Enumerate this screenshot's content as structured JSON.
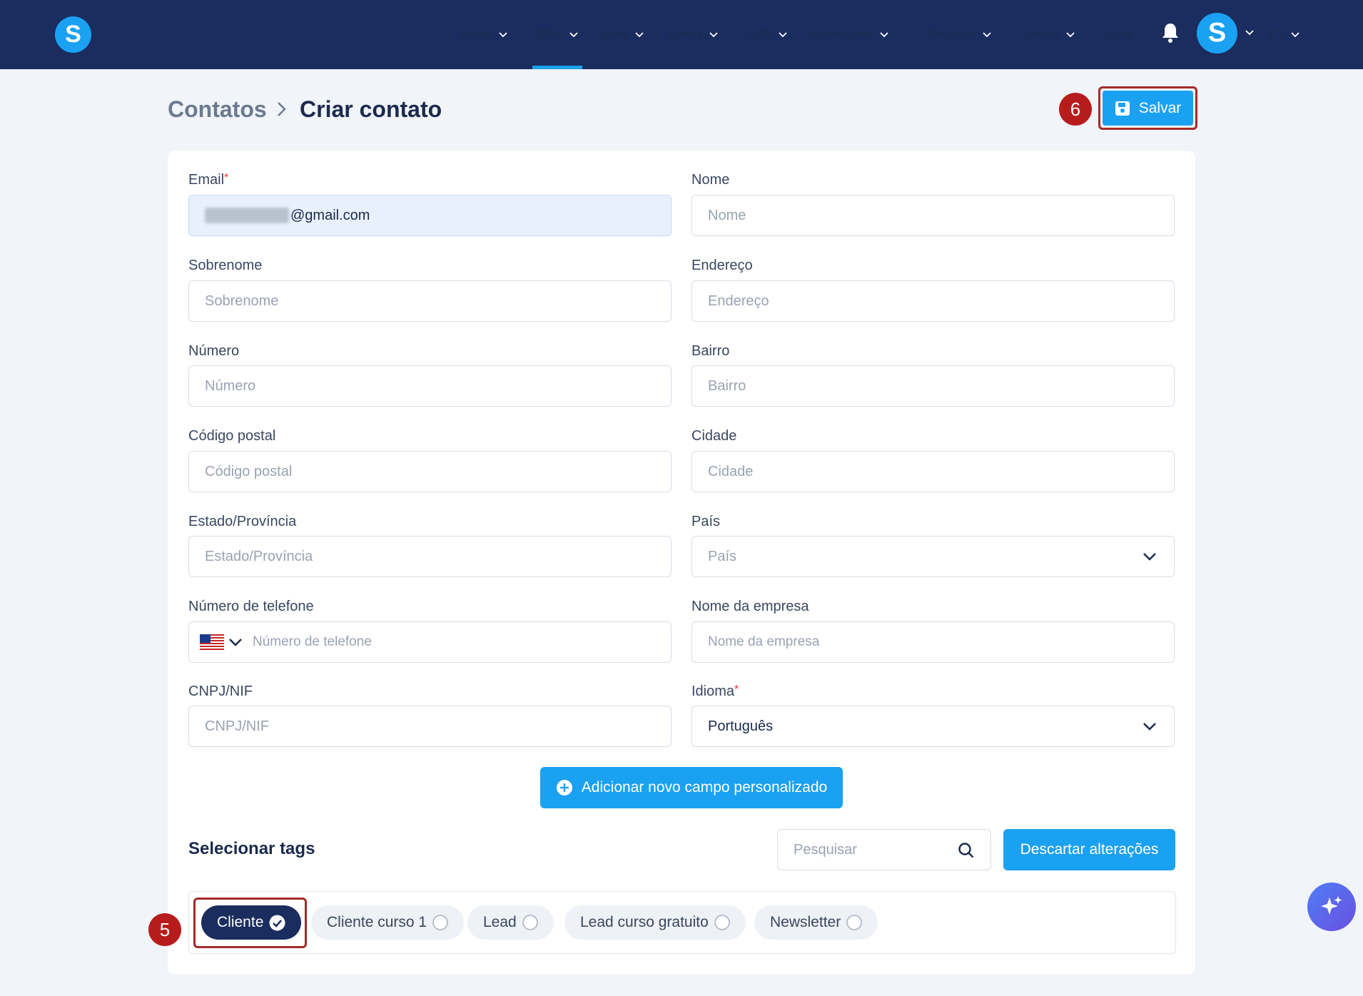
{
  "nav": {
    "items": [
      {
        "label": "Painel",
        "has_dropdown": true
      },
      {
        "label": "CRM",
        "has_dropdown": true,
        "active": true
      },
      {
        "label": "Sites",
        "has_dropdown": true
      },
      {
        "label": "Emails",
        "has_dropdown": true
      },
      {
        "label": "SMS",
        "has_dropdown": true
      },
      {
        "label": "Automações",
        "has_dropdown": true
      },
      {
        "label": "Recursos",
        "has_dropdown": true
      },
      {
        "label": "Vendas",
        "has_dropdown": true
      },
      {
        "label": "Ajuda",
        "has_dropdown": false
      }
    ],
    "logo_letter": "S",
    "avatar_letter": "S",
    "language": "PT",
    "accent": "#1ba1f2",
    "bar_color": "#1a2d5e"
  },
  "header": {
    "breadcrumb_parent": "Contatos",
    "breadcrumb_current": "Criar contato",
    "save_label": "Salvar",
    "step_save": "6"
  },
  "form": {
    "email": {
      "label": "Email",
      "value_suffix": "@gmail.com",
      "required": true
    },
    "nome": {
      "label": "Nome",
      "placeholder": "Nome"
    },
    "sobrenome": {
      "label": "Sobrenome",
      "placeholder": "Sobrenome"
    },
    "endereco": {
      "label": "Endereço",
      "placeholder": "Endereço"
    },
    "numero": {
      "label": "Número",
      "placeholder": "Número"
    },
    "bairro": {
      "label": "Bairro",
      "placeholder": "Bairro"
    },
    "codigo_postal": {
      "label": "Código postal",
      "placeholder": "Código postal"
    },
    "cidade": {
      "label": "Cidade",
      "placeholder": "Cidade"
    },
    "estado": {
      "label": "Estado/Província",
      "placeholder": "Estado/Província"
    },
    "pais": {
      "label": "País",
      "placeholder": "País"
    },
    "telefone": {
      "label": "Número de telefone",
      "placeholder": "Número de telefone"
    },
    "empresa": {
      "label": "Nome da empresa",
      "placeholder": "Nome da empresa"
    },
    "cnpj": {
      "label": "CNPJ/NIF",
      "placeholder": "CNPJ/NIF"
    },
    "idioma": {
      "label": "Idioma",
      "value": "Português",
      "required": true
    },
    "add_custom_field": "Adicionar novo campo personalizado"
  },
  "tags": {
    "title": "Selecionar tags",
    "search_placeholder": "Pesquisar",
    "discard_label": "Descartar alterações",
    "step_tag": "5",
    "items": [
      {
        "label": "Cliente",
        "selected": true
      },
      {
        "label": "Cliente curso 1",
        "selected": false
      },
      {
        "label": "Lead",
        "selected": false
      },
      {
        "label": "Lead curso gratuito",
        "selected": false
      },
      {
        "label": "Newsletter",
        "selected": false
      }
    ]
  }
}
